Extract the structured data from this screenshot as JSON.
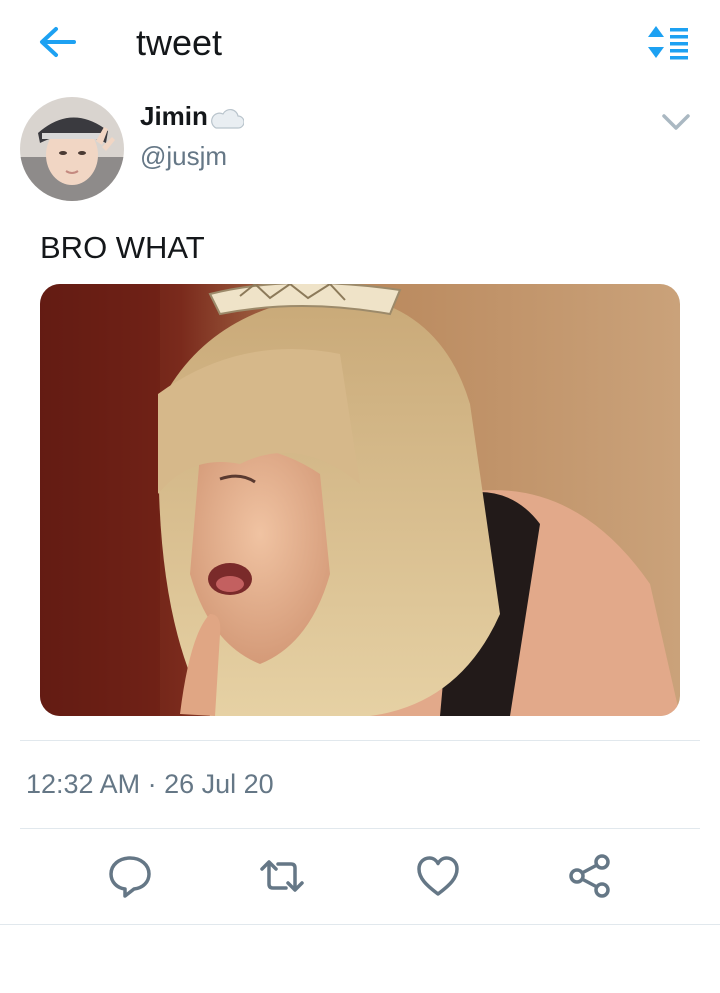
{
  "header": {
    "title": "tweet",
    "back_icon": "arrow-left-icon",
    "sort_icon": "sort-icon",
    "accent_color": "#1da1f2"
  },
  "author": {
    "name": "Jimin",
    "name_emoji": "cloud-emoji",
    "handle": "@jusjm"
  },
  "tweet": {
    "text": "BRO WHAT",
    "timestamp": "12:32 AM · 26 Jul 20"
  },
  "actions": [
    {
      "icon": "reply-icon"
    },
    {
      "icon": "retweet-icon"
    },
    {
      "icon": "like-icon"
    },
    {
      "icon": "share-icon"
    }
  ],
  "colors": {
    "text_primary": "#14171a",
    "text_secondary": "#657786",
    "divider": "#e1e8ed"
  }
}
